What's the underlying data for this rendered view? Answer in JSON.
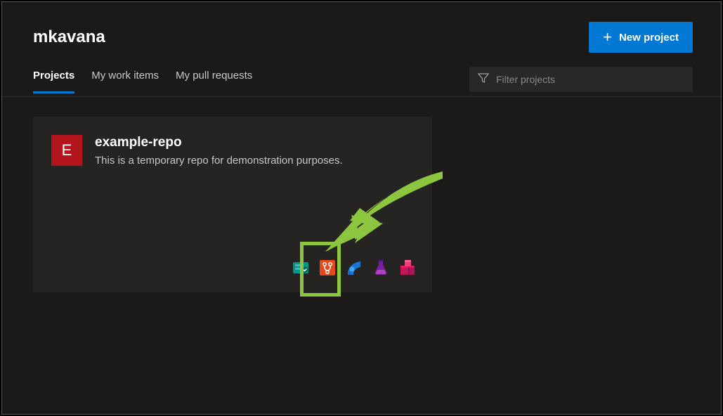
{
  "header": {
    "org_name": "mkavana",
    "new_project_label": "New project"
  },
  "tabs": {
    "items": [
      {
        "label": "Projects",
        "active": true
      },
      {
        "label": "My work items",
        "active": false
      },
      {
        "label": "My pull requests",
        "active": false
      }
    ]
  },
  "filter": {
    "placeholder": "Filter projects"
  },
  "project": {
    "avatar_letter": "E",
    "name": "example-repo",
    "description": "This is a temporary repo for demonstration purposes."
  }
}
